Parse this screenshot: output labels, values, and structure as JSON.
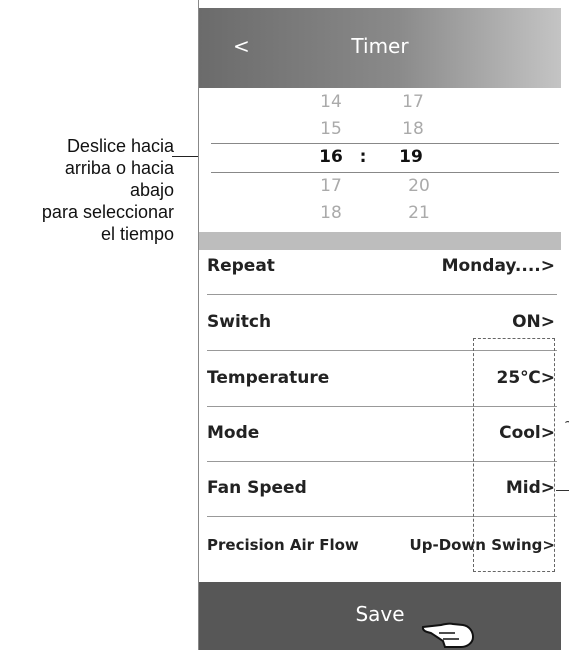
{
  "annotation": {
    "lines": [
      "Deslice hacia",
      "arriba o hacia",
      "abajo",
      "para seleccionar",
      "el tiempo"
    ]
  },
  "header": {
    "back_label": "<",
    "title": "Timer"
  },
  "picker": {
    "hours": [
      "14",
      "15",
      "16",
      "17",
      "18"
    ],
    "minutes": [
      "17",
      "18",
      "19",
      "20",
      "21"
    ],
    "separator": ":",
    "selected_index": 2
  },
  "settings": [
    {
      "label": "Repeat",
      "value": "Monday....>"
    },
    {
      "label": "Switch",
      "value": "ON>"
    },
    {
      "label": "Temperature",
      "value": "25℃>"
    },
    {
      "label": "Mode",
      "value": "Cool>"
    },
    {
      "label": "Fan Speed",
      "value": "Mid>"
    },
    {
      "label": "Precision Air Flow",
      "value": "Up-Down Swing>"
    }
  ],
  "save": {
    "label": "Save"
  },
  "side_mark": "~"
}
